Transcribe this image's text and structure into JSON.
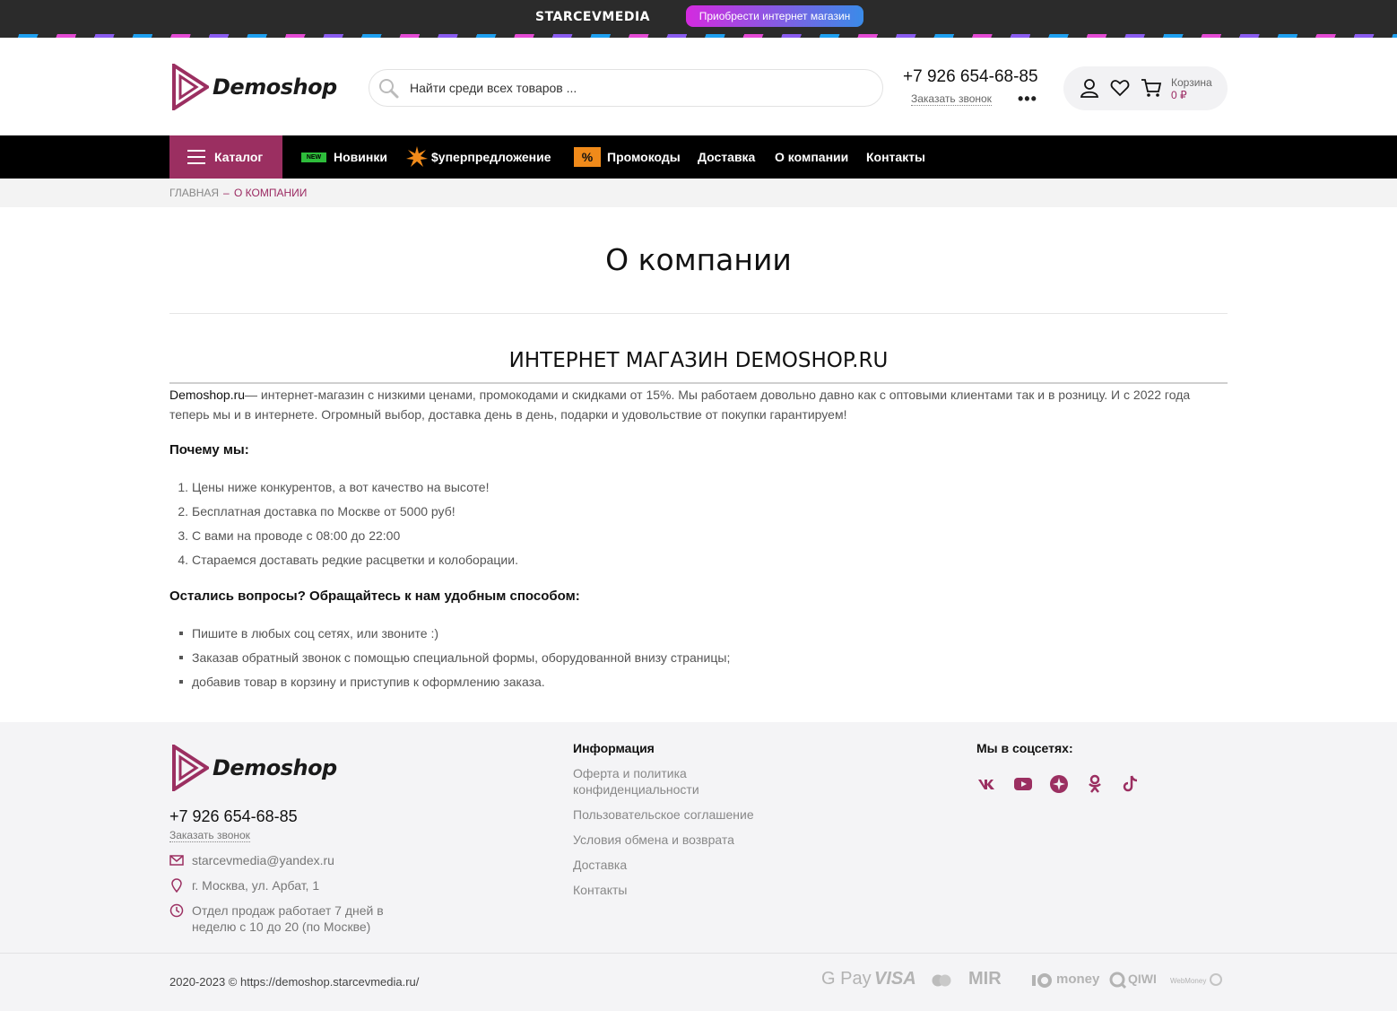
{
  "promo": {
    "brand": "STARCEVMEDIA",
    "button": "Приобрести интернет магазин"
  },
  "header": {
    "logo": "Demoshop",
    "search_placeholder": "Найти среди всех товаров ...",
    "phone": "+7 926 654-68-85",
    "callback": "Заказать звонок",
    "more": "•••",
    "cart_label": "Корзина",
    "cart_sum": "0 ₽"
  },
  "nav": {
    "catalog": "Каталог",
    "new_badge": "NEW",
    "items": [
      "Новинки",
      "$уперпредложение",
      "Промокоды",
      "Доставка",
      "О компании",
      "Контакты"
    ],
    "promo_icon": "%"
  },
  "breadcrumb": {
    "home": "ГЛАВНАЯ",
    "sep": "–",
    "current": "О КОМПАНИИ"
  },
  "page": {
    "title": "О компании",
    "heading": "ИНТЕРНЕТ МАГАЗИН DEMOSHOP.RU",
    "intro_brand": "Demoshop.ru",
    "intro_text": "— интернет-магазин с низкими ценами, промокодами и скидками от 15%. Мы работаем довольно давно как с оптовыми клиентами так и в розницу. И с 2022 года теперь мы и в интернете. Огромный выбор, доставка день в день, подарки и удовольствие от покупки гарантируем!",
    "why_title": "Почему мы:",
    "why_items": [
      "Цены ниже конкурентов, а вот качество на высоте!",
      "Бесплатная доставка по Москве от 5000 руб!",
      "С вами на проводе с 08:00 до 22:00",
      "Стараемся доставать редкие расцветки и колоборации."
    ],
    "questions_title": "Остались вопросы? Обращайтесь к нам удобным способом:",
    "question_items": [
      "Пишите в любых соц сетях, или звоните :)",
      "Заказав обратный звонок с помощью специальной формы, оборудованной внизу страницы;",
      "добавив товар в корзину и приступив к оформлению заказа."
    ]
  },
  "footer": {
    "logo": "Demoshop",
    "phone": "+7 926 654-68-85",
    "callback": "Заказать звонок",
    "email": "starcevmedia@yandex.ru",
    "address": "г. Москва, ул. Арбат, 1",
    "hours": "Отдел продаж работает 7 дней в неделю с 10 до 20 (по Москве)",
    "info_title": "Информация",
    "info_links": [
      "Оферта и политика конфиденциальности",
      "Пользовательское соглашение",
      "Условия обмена и возврата",
      "Доставка",
      "Контакты"
    ],
    "social_title": "Мы в соцсетях:",
    "social_icons": [
      "vk-icon",
      "youtube-icon",
      "odnoklassniki-circle-icon",
      "odnoklassniki-icon",
      "tiktok-icon"
    ],
    "copyright": "2020-2023 © https://demoshop.starcevmedia.ru/",
    "payments": [
      "G Pay",
      "VISA",
      "MIR",
      "money",
      "QIWI",
      "WebMoney"
    ]
  },
  "colors": {
    "accent": "#9b2f61",
    "nav_bg": "#000000",
    "footer_bg": "#f4f4f6"
  }
}
